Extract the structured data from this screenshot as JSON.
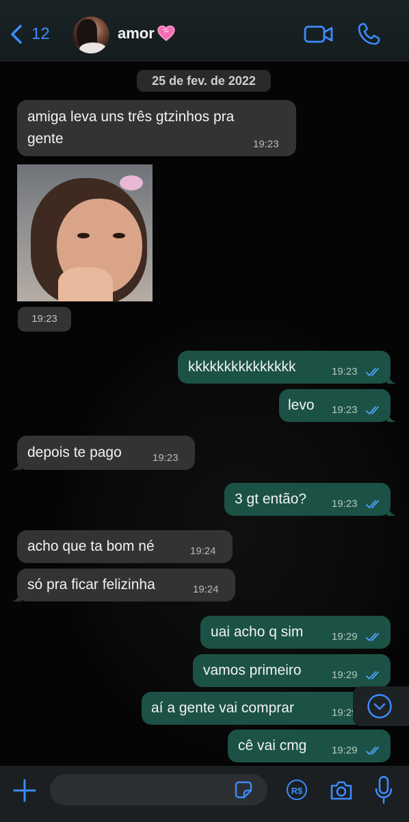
{
  "header": {
    "back_count": "12",
    "contact_name": "amor",
    "contact_emoji": "pink-heart",
    "accent_color": "#3d8bff"
  },
  "date_separator": "25 de fev. de 2022",
  "messages": [
    {
      "dir": "in",
      "text_line1": "amiga leva uns três gtzinhos pra",
      "text_line2": "gente",
      "time": "19:23"
    },
    {
      "dir": "in",
      "type": "image",
      "time": "19:23"
    },
    {
      "dir": "out",
      "text": "kkkkkkkkkkkkkkk",
      "time": "19:23",
      "status": "read"
    },
    {
      "dir": "out",
      "text": "levo",
      "time": "19:23",
      "status": "read"
    },
    {
      "dir": "in",
      "text": "depois te pago",
      "time": "19:23"
    },
    {
      "dir": "out",
      "text": "3 gt então?",
      "time": "19:23",
      "status": "read"
    },
    {
      "dir": "in",
      "text": "acho que ta bom né",
      "time": "19:24"
    },
    {
      "dir": "in",
      "text": "só pra ficar felizinha",
      "time": "19:24"
    },
    {
      "dir": "out",
      "text": "uai acho q sim",
      "time": "19:29",
      "status": "read"
    },
    {
      "dir": "out",
      "text": "vamos primeiro",
      "time": "19:29",
      "status": "read"
    },
    {
      "dir": "out",
      "text": "aí a gente vai comprar",
      "time": "19:29",
      "status": "read"
    },
    {
      "dir": "out",
      "text": "cê vai cmg",
      "time": "19:29",
      "status": "read"
    }
  ],
  "input": {
    "value": "",
    "placeholder": ""
  },
  "colors": {
    "incoming_bubble": "#333333",
    "outgoing_bubble": "#1b5245",
    "read_ticks": "#4fa3ff"
  }
}
